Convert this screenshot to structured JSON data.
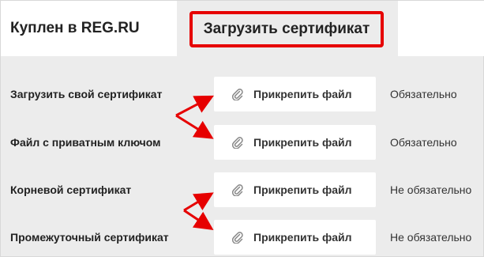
{
  "tabs": {
    "purchased": "Куплен в REG.RU",
    "upload": "Загрузить сертификат"
  },
  "rows": [
    {
      "label": "Загрузить свой сертификат",
      "button": "Прикрепить файл",
      "status": "Обязательно"
    },
    {
      "label": "Файл с приватным ключом",
      "button": "Прикрепить файл",
      "status": "Обязательно"
    },
    {
      "label": "Корневой сертификат",
      "button": "Прикрепить файл",
      "status": "Не обязательно"
    },
    {
      "label": "Промежуточный сертификат",
      "button": "Прикрепить файл",
      "status": "Не обязательно"
    }
  ],
  "colors": {
    "highlight": "#e60000",
    "background": "#ececec",
    "button_bg": "#ffffff"
  },
  "icons": {
    "attach": "paperclip-icon",
    "annotation": "red-arrow"
  }
}
